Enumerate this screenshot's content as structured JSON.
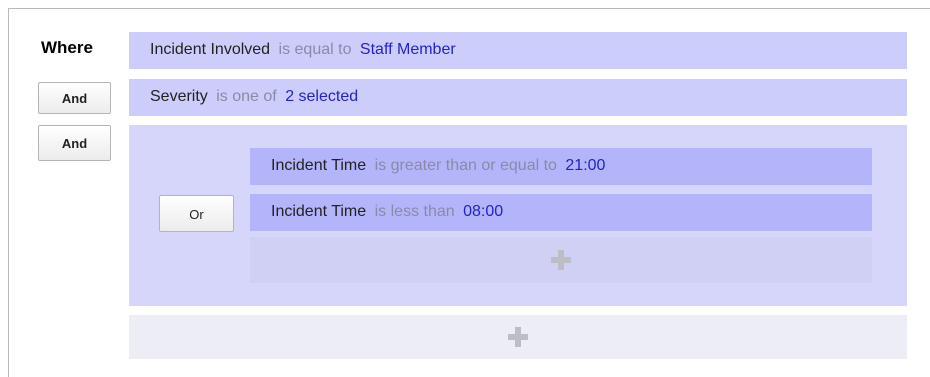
{
  "labels": {
    "where": "Where"
  },
  "buttons": {
    "and1": "And",
    "and2": "And",
    "or": "Or"
  },
  "conditions": [
    {
      "field": "Incident Involved",
      "op": "is equal to",
      "value": "Staff Member"
    },
    {
      "field": "Severity",
      "op": "is one of",
      "value": "2 selected"
    }
  ],
  "group": {
    "conditions": [
      {
        "field": "Incident Time",
        "op": "is greater than or equal to",
        "value": "21:00"
      },
      {
        "field": "Incident Time",
        "op": "is less than",
        "value": "08:00"
      }
    ]
  },
  "colors": {
    "row_bg": "#cdcdfb",
    "group_bg": "#d6d6fb",
    "group_row_bg": "#b4b4fb",
    "value_text": "#2323c8",
    "operator_text": "#8a8aa6"
  },
  "icons": {
    "add_condition": "plus-icon"
  }
}
